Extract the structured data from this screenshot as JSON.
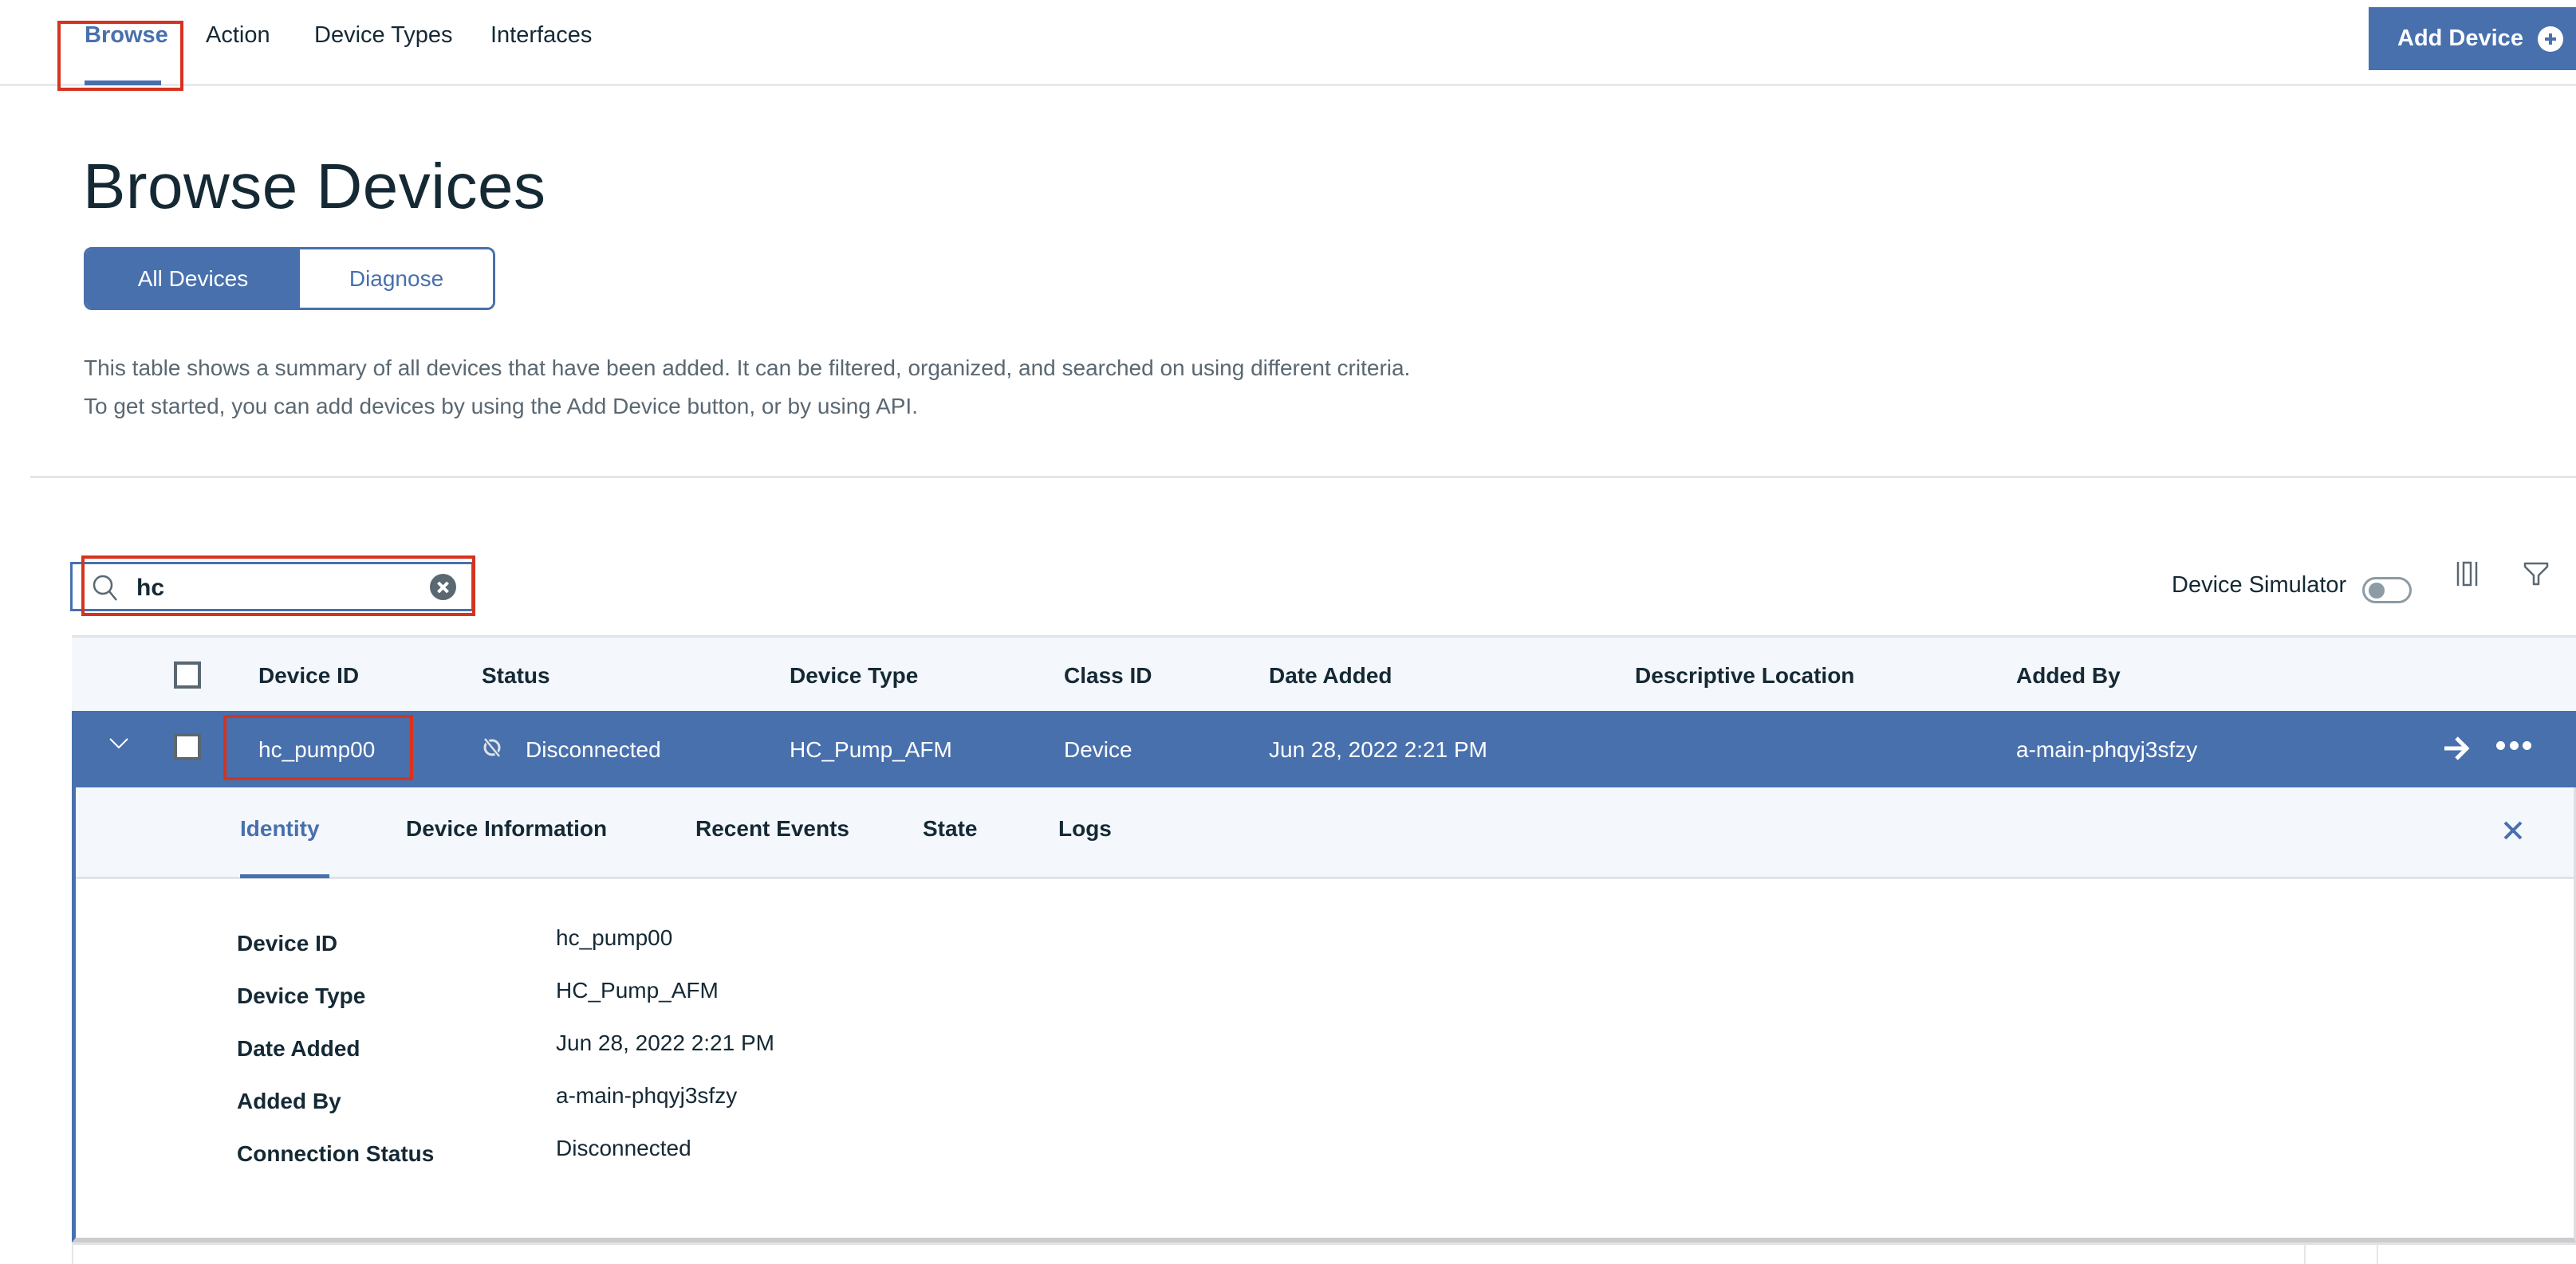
{
  "nav": {
    "tabs": [
      {
        "label": "Browse",
        "active": true
      },
      {
        "label": "Action",
        "active": false
      },
      {
        "label": "Device Types",
        "active": false
      },
      {
        "label": "Interfaces",
        "active": false
      }
    ],
    "add_device_label": "Add Device",
    "add_device_icon": "plus-circle-icon"
  },
  "header": {
    "title": "Browse Devices",
    "segments": [
      {
        "label": "All Devices",
        "active": true
      },
      {
        "label": "Diagnose",
        "active": false
      }
    ],
    "description": "This table shows a summary of all devices that have been added. It can be filtered, organized, and searched on using different criteria. To get started, you can add devices by using the Add Device button, or by using API."
  },
  "toolbar": {
    "search_value": "hc",
    "search_icon": "search-icon",
    "clear_icon": "clear-circle-icon",
    "simulator_label": "Device Simulator",
    "simulator_on": false,
    "columns_icon": "column-settings-icon",
    "filter_icon": "filter-icon"
  },
  "table": {
    "columns": [
      "Device ID",
      "Status",
      "Device Type",
      "Class ID",
      "Date Added",
      "Descriptive Location",
      "Added By"
    ],
    "rows": [
      {
        "device_id": "hc_pump00",
        "status": "Disconnected",
        "status_icon": "disconnected-icon",
        "device_type": "HC_Pump_AFM",
        "class_id": "Device",
        "date_added": "Jun 28, 2022 2:21 PM",
        "descriptive_location": "",
        "added_by": "a-main-phqyj3sfzy",
        "expanded": true,
        "selected": true
      }
    ]
  },
  "details": {
    "tabs": [
      {
        "label": "Identity",
        "active": true
      },
      {
        "label": "Device Information",
        "active": false
      },
      {
        "label": "Recent Events",
        "active": false
      },
      {
        "label": "State",
        "active": false
      },
      {
        "label": "Logs",
        "active": false
      }
    ],
    "fields": [
      {
        "label": "Device ID",
        "value": "hc_pump00"
      },
      {
        "label": "Device Type",
        "value": "HC_Pump_AFM"
      },
      {
        "label": "Date Added",
        "value": "Jun 28, 2022 2:21 PM"
      },
      {
        "label": "Added By",
        "value": "a-main-phqyj3sfzy"
      },
      {
        "label": "Connection Status",
        "value": "Disconnected"
      }
    ]
  },
  "colors": {
    "accent": "#4870ad",
    "highlight": "#d6331f",
    "text": "#152935",
    "muted": "#5a6872",
    "header_bg": "#f4f7fb"
  }
}
